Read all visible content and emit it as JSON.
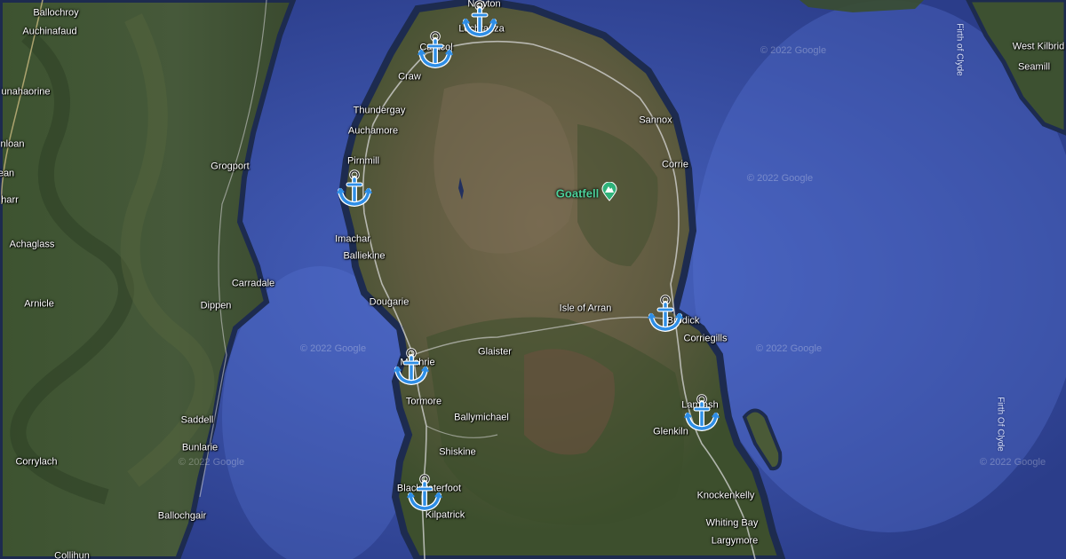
{
  "map": {
    "watermark": "© 2022 Google",
    "colors": {
      "sea": "#2c3f8e",
      "sea_light": "#3a56b5",
      "land_dark": "#2f4429",
      "land_mid": "#4f5f3a",
      "land_brown": "#6a6045",
      "anchor": "#2e8ee6",
      "peak": "#4cd19a"
    },
    "water_labels": [
      {
        "id": "firth-clyde-top",
        "text": "Firth of Clyde"
      },
      {
        "id": "firth-clyde-right",
        "text": "Firth Of Clyde"
      }
    ],
    "place_labels": {
      "ballochroy": "Ballochroy",
      "auchinafaud": "Auchinafaud",
      "runahaorine": "Runahaorine",
      "rhunahaorine_cut": "unahaorine",
      "hloan": "nloan",
      "ean": "ean",
      "harr": "harr",
      "achaglass": "Achaglass",
      "arnicle": "Arnicle",
      "grogport": "Grogport",
      "carradale": "Carradale",
      "dippen": "Dippen",
      "saddell": "Saddell",
      "bunlarie": "Bunlarie",
      "corrylach": "Corrylach",
      "ballochgair": "Ballochgair",
      "lochranza": "Lochranza",
      "newton": "Newton",
      "catacol": "Catacol",
      "craw": "Craw",
      "thundergay": "Thundergay",
      "auchamore": "Auchamore",
      "pirnmill": "Pirnmill",
      "imachar": "Imachar",
      "balliekine": "Balliekine",
      "dougarie": "Dougarie",
      "machrie": "Machrie",
      "tormore": "Tormore",
      "glaister": "Glaister",
      "ballymichael": "Ballymichael",
      "shiskine": "Shiskine",
      "blackwaterfoot": "Blackwaterfoot",
      "kilpatrick": "Kilpatrick",
      "sannox": "Sannox",
      "corrie": "Corrie",
      "isle_of_arran": "Isle of Arran",
      "brodick": "Brodick",
      "corriegills": "Corriegills",
      "lamlash": "Lamlash",
      "glenkiln": "Glenkiln",
      "knockenkelly": "Knockenkelly",
      "whiting_bay": "Whiting Bay",
      "largymore": "Largymore",
      "west_kilbride": "West Kilbrid",
      "seamill": "Seamill",
      "collihun": "Collihun"
    },
    "poi": {
      "goatfell": "Goatfell"
    },
    "markers": [
      {
        "id": "newton",
        "icon": "anchor-icon"
      },
      {
        "id": "catacol",
        "icon": "anchor-icon"
      },
      {
        "id": "pirnmill",
        "icon": "anchor-icon"
      },
      {
        "id": "machrie",
        "icon": "anchor-icon"
      },
      {
        "id": "blackwaterfoot",
        "icon": "anchor-icon"
      },
      {
        "id": "brodick",
        "icon": "anchor-icon"
      },
      {
        "id": "lamlash",
        "icon": "anchor-icon"
      }
    ]
  }
}
